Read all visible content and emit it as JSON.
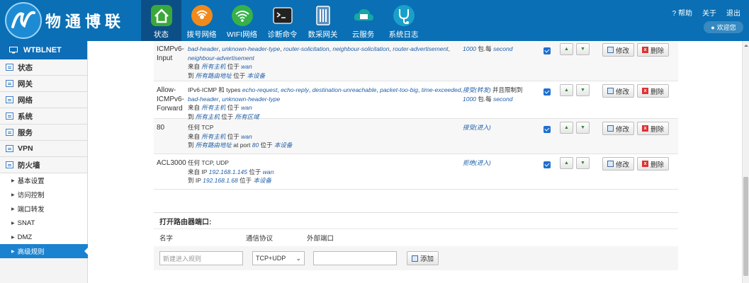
{
  "header": {
    "brand": "物通博联",
    "nav": [
      {
        "label": "状态",
        "icon": "home-icon",
        "active": true
      },
      {
        "label": "拨号网络",
        "icon": "dialup-icon",
        "active": false
      },
      {
        "label": "WIFI网络",
        "icon": "wifi-icon",
        "active": false
      },
      {
        "label": "诊断命令",
        "icon": "terminal-icon",
        "active": false
      },
      {
        "label": "数采网关",
        "icon": "gateway-icon",
        "active": false
      },
      {
        "label": "云服务",
        "icon": "cloud-icon",
        "active": false
      },
      {
        "label": "系统日志",
        "icon": "stethoscope-icon",
        "active": false
      }
    ],
    "links": {
      "help": "? 帮助",
      "about": "关于",
      "logout": "退出"
    },
    "welcome": "欢迎您"
  },
  "sidebar": {
    "title": "WTBLNET",
    "items": [
      {
        "label": "状态"
      },
      {
        "label": "网关"
      },
      {
        "label": "网络"
      },
      {
        "label": "系统"
      },
      {
        "label": "服务"
      },
      {
        "label": "VPN"
      },
      {
        "label": "防火墙"
      }
    ],
    "subitems": [
      {
        "label": "基本设置"
      },
      {
        "label": "访问控制"
      },
      {
        "label": "端口转发"
      },
      {
        "label": "SNAT"
      },
      {
        "label": "DMZ"
      },
      {
        "label": "高级规则"
      }
    ]
  },
  "rules": [
    {
      "name": [
        "ICMPv6-",
        "Input"
      ],
      "desc_html": "<i>bad-header</i>, <i>unknown-header-type</i>, <i>router-solicitation</i>, <i>neighbour-solicitation</i>, <i>router-advertisement</i>,<br><i>neighbour-advertisement</i><br>来自 <i>所有主机</i> 位于 <i>wan</i><br>到 <i>所有路由地址</i> 位于 <i>本设备</i>",
      "action_html": "<i>1000</i> 包.每 <i>second</i>"
    },
    {
      "name": [
        "Allow-",
        "ICMPv6-",
        "Forward"
      ],
      "desc_html": "IPv6-ICMP 和 types <i>echo-request</i>, <i>echo-reply</i>, <i>destination-unreachable</i>, <i>packet-too-big</i>, <i>time-exceeded</i>,<br><i>bad-header</i>, <i>unknown-header-type</i><br>来自 <i>所有主机</i> 位于 <i>wan</i><br>到 <i>所有主机</i> 位于 <i>所有区域</i>",
      "action_html": "<i>接受(转发)</i> 并且限制到<br><i>1000</i> 包.每 <i>second</i>"
    },
    {
      "name": [
        "80"
      ],
      "desc_html": "任何 TCP<br>来自 <i>所有主机</i> 位于 <i>wan</i><br>到 <i>所有路由地址</i> at port <i>80</i> 位于 <i>本设备</i>",
      "action_html": "<i>接受(进入)</i>"
    },
    {
      "name": [
        "ACL3000"
      ],
      "desc_html": "任何 TCP, UDP<br>来自 IP <i>192.168.1.145</i> 位于 <i>wan</i><br>到 IP <i>192.168.1.68</i> 位于 <i>本设备</i>",
      "action_html": "<i>拒绝(进入)</i>"
    }
  ],
  "rule_buttons": {
    "up": "▲",
    "down": "▼",
    "edit": "修改",
    "delete": "删除"
  },
  "open_port": {
    "title": "打开路由器端口:",
    "col_name": "名字",
    "col_proto": "通信协议",
    "col_port": "外部端口",
    "name_placeholder": "新建进入规则",
    "proto_value": "TCP+UDP",
    "add_label": "添加"
  }
}
